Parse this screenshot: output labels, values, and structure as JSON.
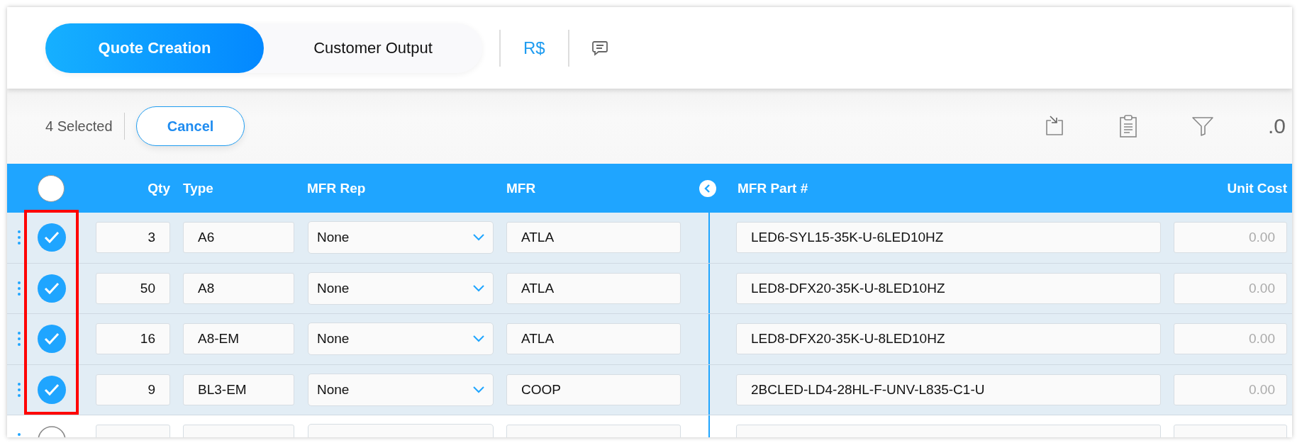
{
  "tabs": [
    {
      "label": "Quote Creation",
      "selected": true
    },
    {
      "label": "Customer Output",
      "selected": false
    }
  ],
  "currency_button": {
    "label": "R$"
  },
  "selection_bar": {
    "count": "4 Selected",
    "cancel": "Cancel",
    "overflow_text": ".0"
  },
  "table": {
    "select_all_checked": false,
    "columns": [
      "Qty",
      "Type",
      "MFR Rep",
      "MFR",
      "MFR Part #",
      "Unit Cost"
    ],
    "rows": [
      {
        "selected": true,
        "qty": "3",
        "type": "A6",
        "mfr_rep": "None",
        "mfr": "ATLA",
        "mfr_part": "LED6-SYL15-35K-U-6LED10HZ",
        "unit_cost": "0.00"
      },
      {
        "selected": true,
        "qty": "50",
        "type": "A8",
        "mfr_rep": "None",
        "mfr": "ATLA",
        "mfr_part": "LED8-DFX20-35K-U-8LED10HZ",
        "unit_cost": "0.00"
      },
      {
        "selected": true,
        "qty": "16",
        "type": "A8-EM",
        "mfr_rep": "None",
        "mfr": "ATLA",
        "mfr_part": "LED8-DFX20-35K-U-8LED10HZ",
        "unit_cost": "0.00"
      },
      {
        "selected": true,
        "qty": "9",
        "type": "BL3-EM",
        "mfr_rep": "None",
        "mfr": "COOP",
        "mfr_part": "2BCLED-LD4-28HL-F-UNV-L835-C1-U",
        "unit_cost": "0.00"
      },
      {
        "selected": false
      }
    ]
  }
}
